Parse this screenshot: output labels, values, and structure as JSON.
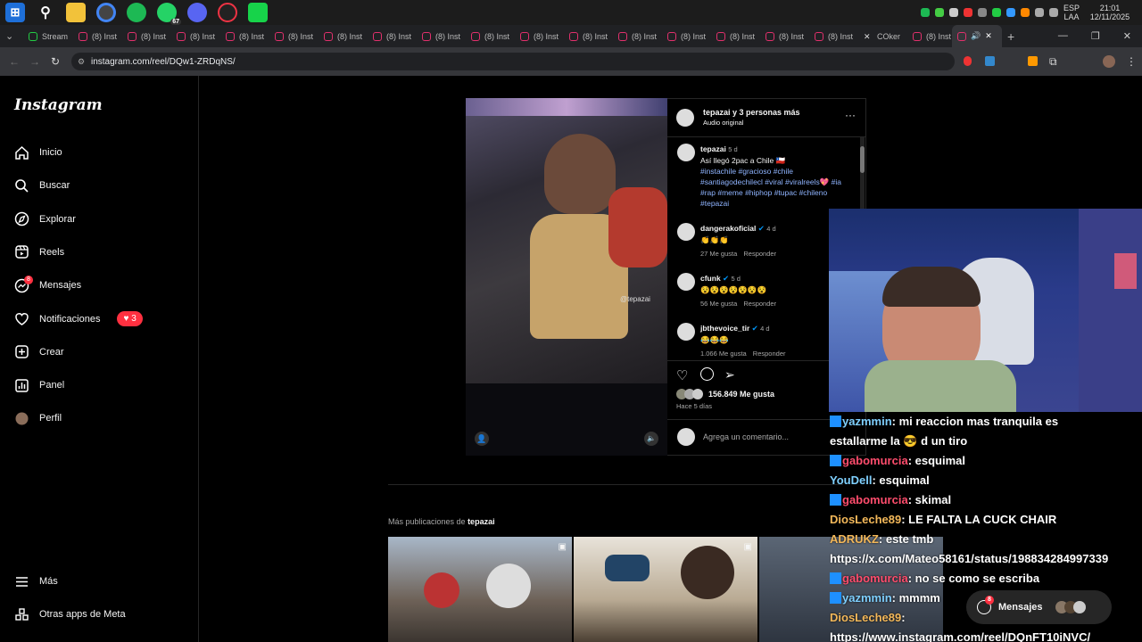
{
  "taskbar": {
    "icons": [
      "windows-start-icon",
      "search-icon",
      "file-explorer-icon",
      "chrome-icon",
      "spotify-icon",
      "whatsapp-icon",
      "discord-icon",
      "app-icon",
      "green-app-icon"
    ],
    "whatsapp_badge": "67",
    "lang_top": "ESP",
    "lang_bottom": "LAA",
    "time": "21:01",
    "date": "12/11/2025"
  },
  "tabs": [
    {
      "label": "Stream",
      "icon": "stream-icon"
    },
    {
      "label": "(8) Inst",
      "icon": "instagram-icon"
    },
    {
      "label": "(8) Inst",
      "icon": "instagram-icon"
    },
    {
      "label": "(8) Inst",
      "icon": "instagram-icon"
    },
    {
      "label": "(8) Inst",
      "icon": "instagram-icon"
    },
    {
      "label": "(8) Inst",
      "icon": "instagram-icon"
    },
    {
      "label": "(8) Inst",
      "icon": "instagram-icon"
    },
    {
      "label": "(8) Inst",
      "icon": "instagram-icon"
    },
    {
      "label": "(8) Inst",
      "icon": "instagram-icon"
    },
    {
      "label": "(8) Inst",
      "icon": "instagram-icon"
    },
    {
      "label": "(8) Inst",
      "icon": "instagram-icon"
    },
    {
      "label": "(8) Inst",
      "icon": "instagram-icon"
    },
    {
      "label": "(8) Inst",
      "icon": "instagram-icon"
    },
    {
      "label": "(8) Inst",
      "icon": "instagram-icon"
    },
    {
      "label": "(8) Inst",
      "icon": "instagram-icon"
    },
    {
      "label": "(8) Inst",
      "icon": "instagram-icon"
    },
    {
      "label": "(8) Inst",
      "icon": "instagram-icon"
    },
    {
      "label": "COker",
      "icon": "x-icon"
    },
    {
      "label": "(8) Inst",
      "icon": "instagram-icon"
    }
  ],
  "address": {
    "url": "instagram.com/reel/DQw1-ZRDqNS/"
  },
  "instagram": {
    "logo": "Instagram",
    "nav": [
      {
        "label": "Inicio",
        "icon": "home-icon"
      },
      {
        "label": "Buscar",
        "icon": "search-icon"
      },
      {
        "label": "Explorar",
        "icon": "compass-icon"
      },
      {
        "label": "Reels",
        "icon": "reels-icon"
      },
      {
        "label": "Mensajes",
        "icon": "messenger-icon",
        "badge": "8"
      },
      {
        "label": "Notificaciones",
        "icon": "heart-icon",
        "pill": "3"
      },
      {
        "label": "Crear",
        "icon": "plus-square-icon"
      },
      {
        "label": "Panel",
        "icon": "chart-icon"
      },
      {
        "label": "Perfil",
        "icon": "profile-icon"
      }
    ],
    "more": "Más",
    "meta_apps": "Otras apps de Meta"
  },
  "post": {
    "author_line": "tepazai y 3 personas más",
    "audio": "Audio original",
    "watermark": "@tepazai",
    "caption_user": "tepazai",
    "caption_age": "5 d",
    "caption_text": "Así llegó 2pac a Chile 🇨🇱",
    "hashtags": "#instachile #gracioso #chile #santiagodechilecl #viral #viralreels💖 #ia #rap #meme #hiphop #tupac #chileno #tepazai",
    "comments": [
      {
        "user": "dangerakoficial",
        "age": "4 d",
        "text": "👏👏👏",
        "likes": "27 Me gusta",
        "reply": "Responder"
      },
      {
        "user": "cfunk",
        "age": "5 d",
        "text": "😵😵😵😵😵😵😵",
        "likes": "56 Me gusta",
        "reply": "Responder"
      },
      {
        "user": "jbthevoice_tir",
        "age": "4 d",
        "text": "😂😂😂",
        "likes": "1.066 Me gusta",
        "reply": "Responder"
      }
    ],
    "likes": "156.849 Me gusta",
    "posted": "Hace 5 días",
    "comment_placeholder": "Agrega un comentario..."
  },
  "more_posts": {
    "prefix": "Más publicaciones de ",
    "user": "tepazai"
  },
  "chat": [
    {
      "badge": true,
      "user": "yazmmin",
      "color": "#7fd0ff",
      "text": "mi reaccion mas tranquila es"
    },
    {
      "badge": false,
      "user": "",
      "color": "#ffffff",
      "text": "estallarme la 😎 d un tiro"
    },
    {
      "badge": true,
      "user": "gabomurcia",
      "color": "#ff4d6d",
      "text": "esquimal"
    },
    {
      "badge": false,
      "user": "YouDell",
      "color": "#7fd0ff",
      "text": "esquimal"
    },
    {
      "badge": true,
      "user": "gabomurcia",
      "color": "#ff4d6d",
      "text": "skimal"
    },
    {
      "badge": false,
      "user": "DiosLeche89",
      "color": "#f3b85a",
      "text": "LE FALTA LA CUCK CHAIR"
    },
    {
      "badge": false,
      "user": "ADRUKZ",
      "color": "#f3b85a",
      "text": "este tmb"
    },
    {
      "badge": false,
      "user": "",
      "color": "#ffffff",
      "text": "https://x.com/Mateo58161/status/198834284997339"
    },
    {
      "badge": true,
      "user": "gabomurcia",
      "color": "#ff4d6d",
      "text": "no se como se escriba"
    },
    {
      "badge": true,
      "user": "yazmmin",
      "color": "#7fd0ff",
      "text": "mmmm"
    },
    {
      "badge": false,
      "user": "DiosLeche89",
      "color": "#f3b85a",
      "text": ""
    },
    {
      "badge": false,
      "user": "",
      "color": "#ffffff",
      "text": "https://www.instagram.com/reel/DQnFT10iNVC/"
    }
  ],
  "messages_float": {
    "label": "Mensajes",
    "badge": "8"
  }
}
